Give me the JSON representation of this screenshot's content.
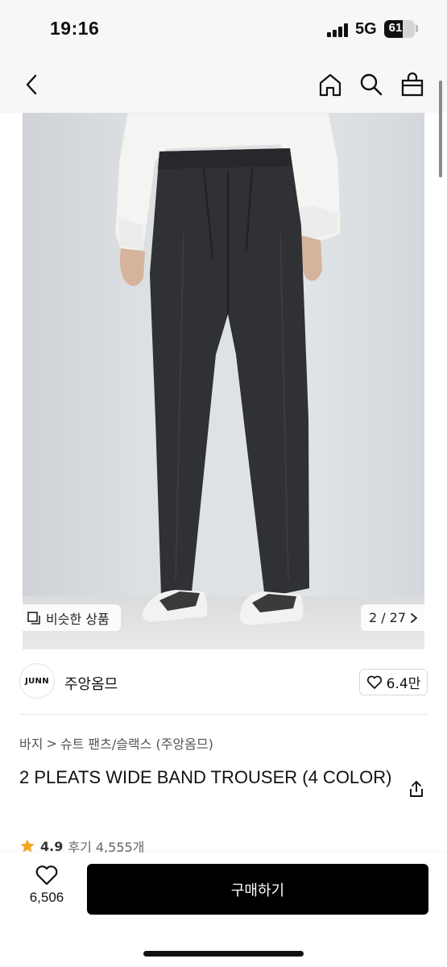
{
  "status_bar": {
    "time": "19:16",
    "network": "5G",
    "battery": "61",
    "battery_level_percent": 61
  },
  "nav": {
    "icons": [
      "back-icon",
      "home-icon",
      "search-icon",
      "shopping-bag-icon"
    ]
  },
  "image_overlay": {
    "similar_label": "비슷한 상품",
    "page_counter": "2 / 27"
  },
  "seller": {
    "logo_text": "JUNN",
    "name": "주앙옴므",
    "likes": "6.4만"
  },
  "product": {
    "breadcrumb_parent": "바지",
    "breadcrumb_separator": ">",
    "breadcrumb_child": "슈트 팬츠/슬랙스 (주앙옴므)",
    "title": "2 PLEATS WIDE BAND TROUSER (4 COLOR)",
    "rating": "4.9",
    "review_label": "후기 4,555개"
  },
  "bottom_bar": {
    "wish_count": "6,506",
    "buy_label": "구매하기"
  },
  "colors": {
    "accent": "#000000",
    "star": "#f5a623"
  }
}
